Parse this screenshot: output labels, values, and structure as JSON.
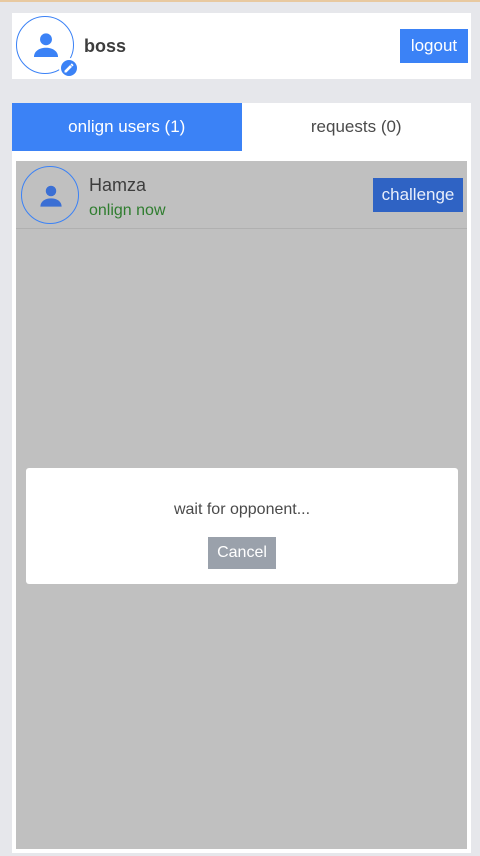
{
  "header": {
    "username": "boss",
    "logout_label": "logout",
    "avatar_icon": "person-icon",
    "edit_icon": "pencil-icon"
  },
  "tabs": [
    {
      "label": "onlign users (1)",
      "active": true
    },
    {
      "label": "requests (0)",
      "active": false
    }
  ],
  "users": [
    {
      "name": "Hamza",
      "status": "onlign now",
      "action_label": "challenge"
    }
  ],
  "modal": {
    "message": "wait for opponent...",
    "cancel_label": "Cancel"
  },
  "colors": {
    "accent": "#3b82f6",
    "challenge": "#2f63c4",
    "status_online": "#2f7d2f",
    "overlay": "#c0c0c0",
    "cancel": "#9aa1ab"
  }
}
